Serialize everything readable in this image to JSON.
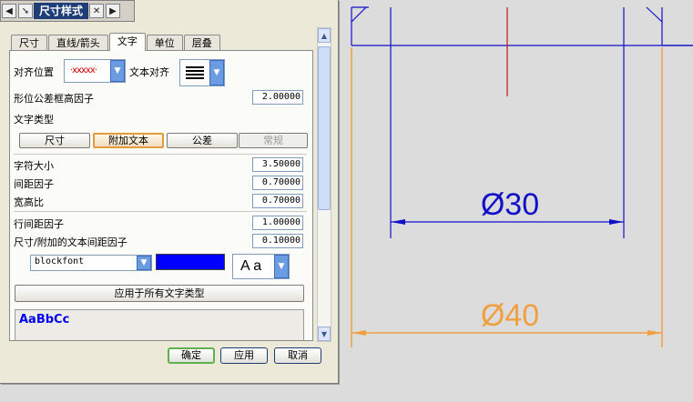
{
  "dialog": {
    "title": "尺寸样式",
    "titlebar_icons": [
      "chevron-left-icon",
      "pin-icon",
      "close-icon",
      "chevron-right-icon"
    ],
    "tabs": [
      "尺寸",
      "直线/箭头",
      "文字",
      "单位",
      "层叠"
    ],
    "active_tab": "文字",
    "align_position_label": "对齐位置",
    "align_position_value": "·xxxxx·",
    "text_align_label": "文本对齐",
    "gdt_frame_label": "形位公差框高因子",
    "gdt_frame_value": "2.00000",
    "text_type_label": "文字类型",
    "text_types": [
      "尺寸",
      "附加文本",
      "公差",
      "常规"
    ],
    "selected_text_type": "附加文本",
    "char_size_label": "字符大小",
    "char_size_value": "3.50000",
    "spacing_label": "间距因子",
    "spacing_value": "0.70000",
    "aspect_label": "宽高比",
    "aspect_value": "0.70000",
    "line_spacing_label": "行间距因子",
    "line_spacing_value": "1.00000",
    "dim_text_spacing_label": "尺寸/附加的文本间距因子",
    "dim_text_spacing_value": "0.10000",
    "font_value": "blockfont",
    "font_style_value": "A a",
    "text_color": "#0000ff",
    "apply_all_label": "应用于所有文字类型",
    "preview_text": "AaBbCc",
    "ok_label": "确定",
    "apply_label": "应用",
    "cancel_label": "取消"
  },
  "drawing": {
    "dim_inner": "Ø30",
    "dim_outer": "Ø40",
    "colors": {
      "inner": "#1010c8",
      "outer": "#f0a040",
      "centerline": "#d01010"
    }
  }
}
